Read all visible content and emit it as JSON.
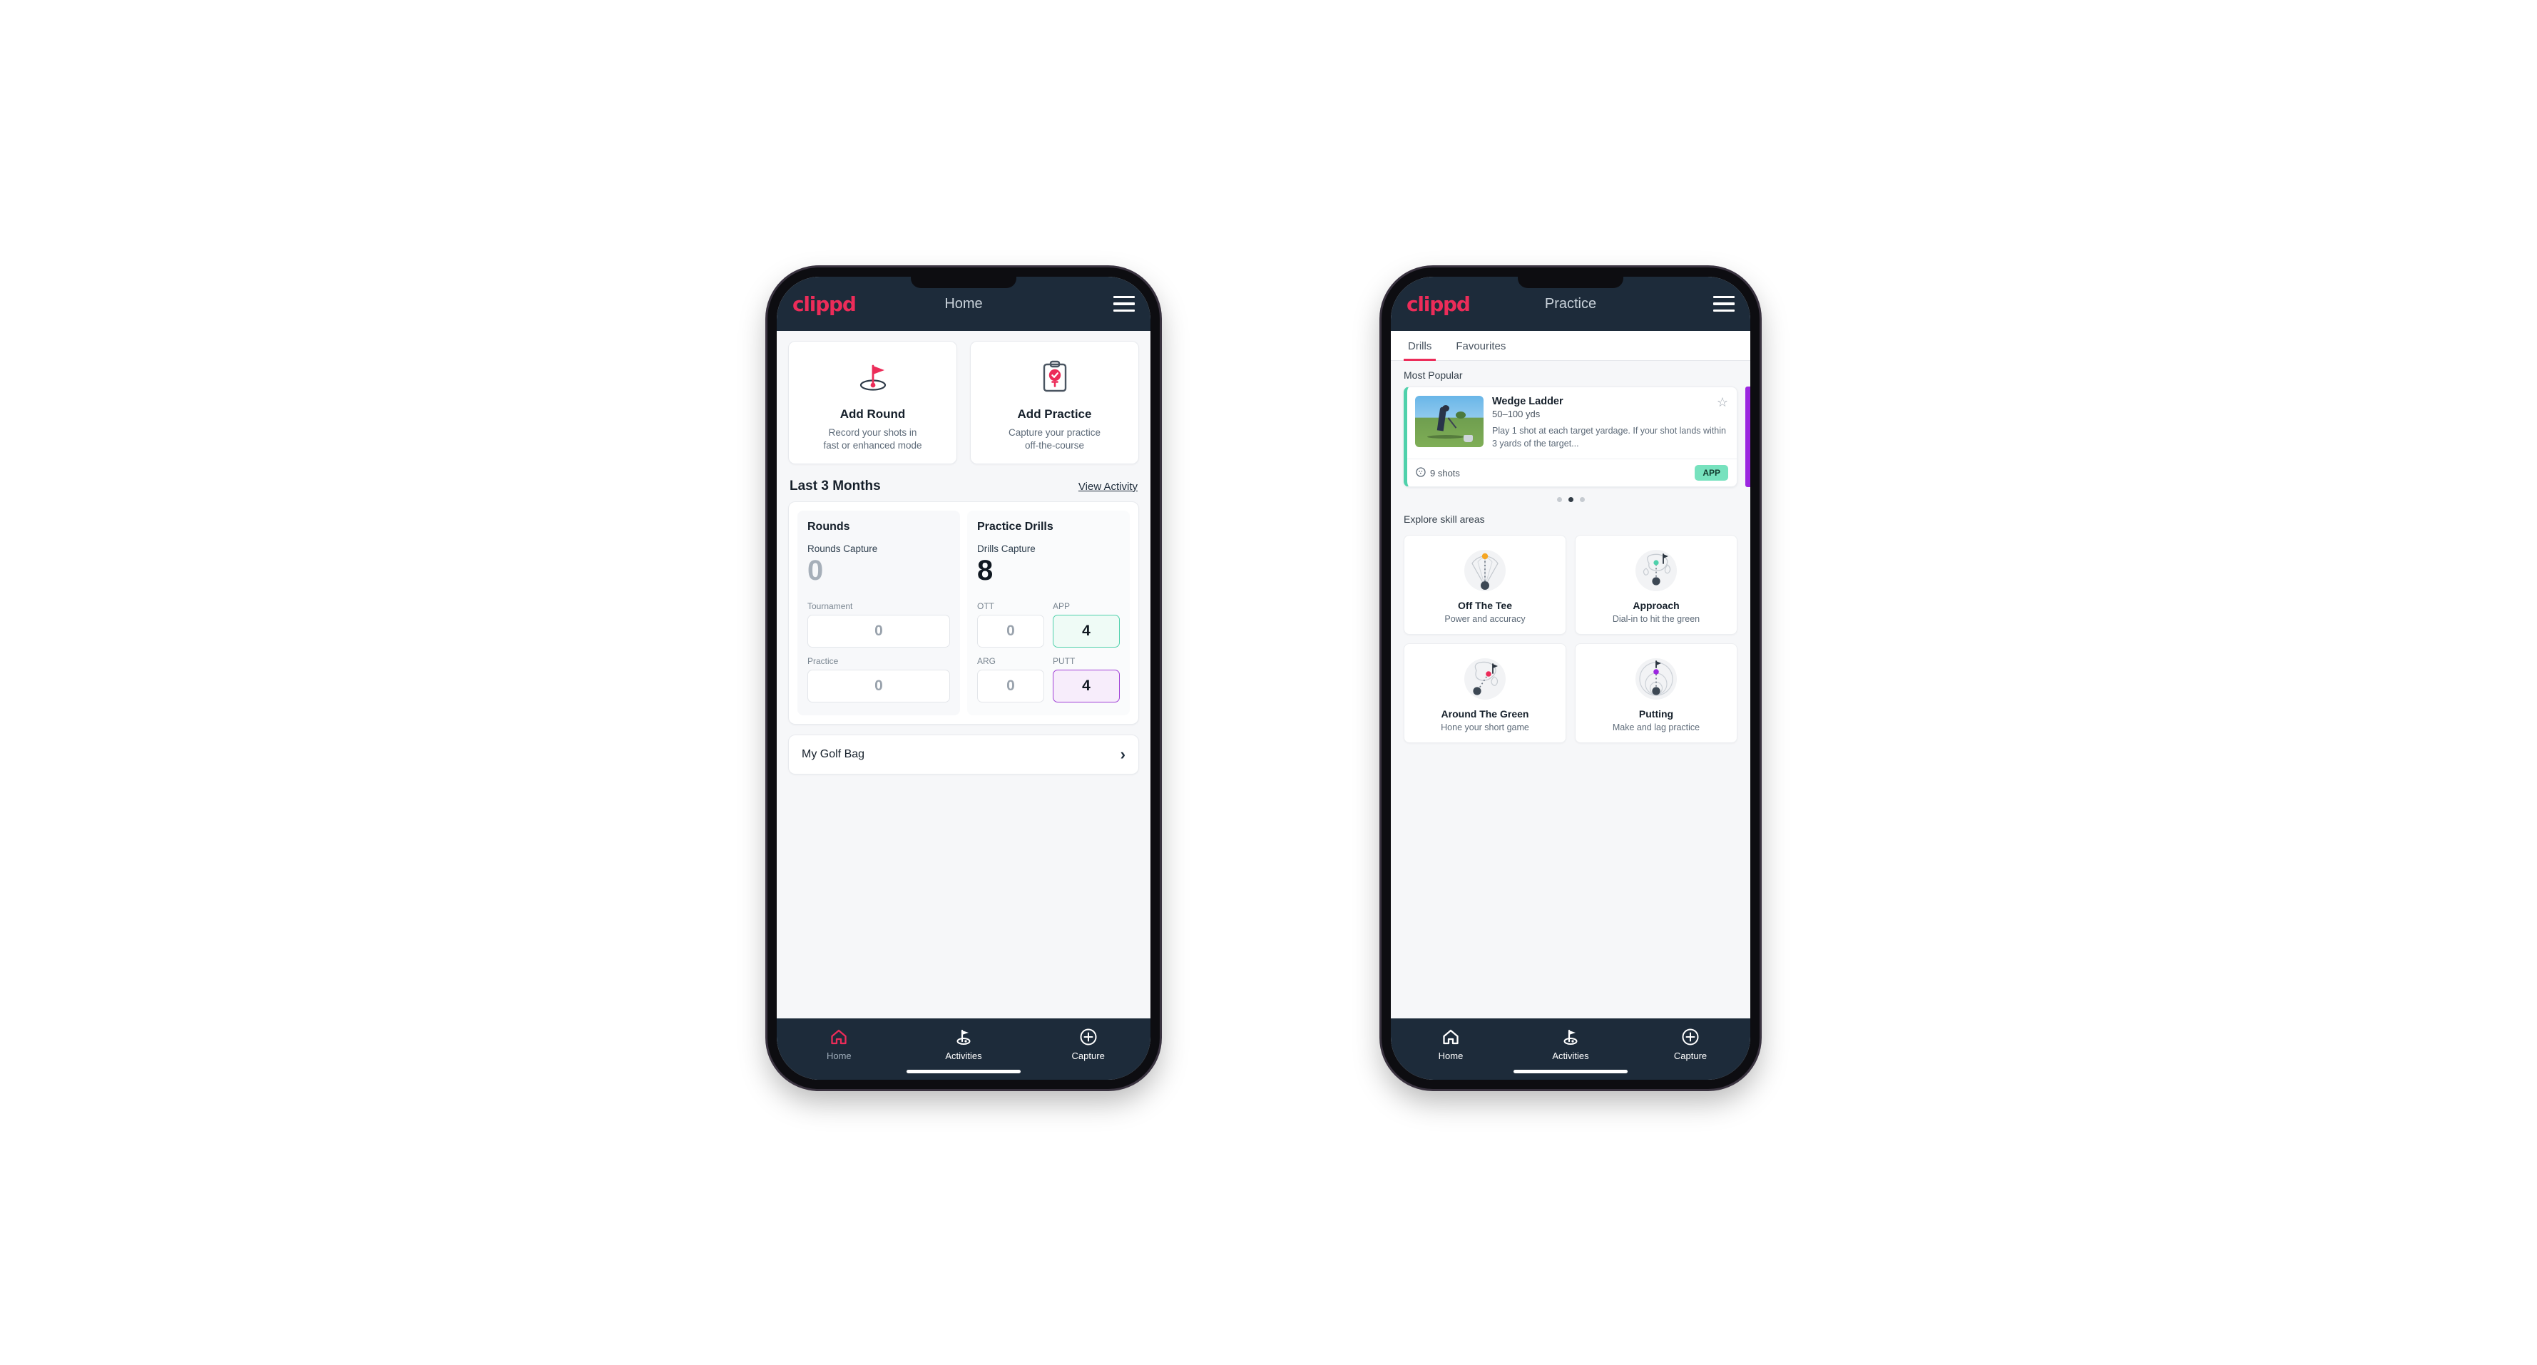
{
  "brand": {
    "logo_text": "clippd",
    "accent_pink": "#ec2c59",
    "navy": "#1d2b3a"
  },
  "phone1": {
    "appbar": {
      "title": "Home",
      "menu_icon": "hamburger-icon"
    },
    "quick_actions": [
      {
        "icon": "golf-flag-hole-icon",
        "title": "Add Round",
        "subtitle_line1": "Record your shots in",
        "subtitle_line2": "fast or enhanced mode"
      },
      {
        "icon": "clipboard-check-tee-icon",
        "title": "Add Practice",
        "subtitle_line1": "Capture your practice",
        "subtitle_line2": "off-the-course"
      }
    ],
    "section": {
      "title": "Last 3 Months",
      "link": "View Activity"
    },
    "rounds": {
      "title": "Rounds",
      "capture_label": "Rounds Capture",
      "capture_value": "0",
      "tournament_label": "Tournament",
      "tournament_value": "0",
      "practice_label": "Practice",
      "practice_value": "0"
    },
    "drills": {
      "title": "Practice Drills",
      "capture_label": "Drills Capture",
      "capture_value": "8",
      "ott_label": "OTT",
      "ott_value": "0",
      "app_label": "APP",
      "app_value": "4",
      "app_color": "#4fd1ab",
      "arg_label": "ARG",
      "arg_value": "0",
      "putt_label": "PUTT",
      "putt_value": "4",
      "putt_color": "#a13fd6"
    },
    "golf_bag": {
      "label": "My Golf Bag",
      "chevron": "›"
    },
    "nav": [
      {
        "icon": "home-icon",
        "label": "Home",
        "active": true
      },
      {
        "icon": "golf-flag-icon",
        "label": "Activities",
        "active": false
      },
      {
        "icon": "plus-circle-icon",
        "label": "Capture",
        "active": false
      }
    ]
  },
  "phone2": {
    "appbar": {
      "title": "Practice",
      "menu_icon": "hamburger-icon"
    },
    "tabs": [
      {
        "label": "Drills",
        "active": true
      },
      {
        "label": "Favourites",
        "active": false
      }
    ],
    "most_popular_label": "Most Popular",
    "drill": {
      "name": "Wedge Ladder",
      "yardage": "50–100 yds",
      "description": "Play 1 shot at each target yardage. If your shot lands within 3 yards of the target...",
      "shots": "9 shots",
      "shots_icon": "golf-ball-icon",
      "badge": "APP",
      "badge_color": "#77e2be",
      "accent_color": "#4fd1ab",
      "favourite_icon": "star-outline-icon",
      "thumbnail": "golfer-chipping-photo"
    },
    "carousel_dots": {
      "count": 3,
      "active_index": 1
    },
    "skills_label": "Explore skill areas",
    "skills": [
      {
        "icon": "tee-fan-icon",
        "title": "Off The Tee",
        "subtitle": "Power and accuracy",
        "dot_color": "#f5a623"
      },
      {
        "icon": "green-approach-icon",
        "title": "Approach",
        "subtitle": "Dial-in to hit the green",
        "dot_color": "#4fd1ab"
      },
      {
        "icon": "chip-green-icon",
        "title": "Around The Green",
        "subtitle": "Hone your short game",
        "dot_color": "#ec2c59"
      },
      {
        "icon": "putting-rings-icon",
        "title": "Putting",
        "subtitle": "Make and lag practice",
        "dot_color": "#9c27e0"
      }
    ],
    "nav": [
      {
        "icon": "home-icon",
        "label": "Home",
        "active": false
      },
      {
        "icon": "golf-flag-icon",
        "label": "Activities",
        "active": true
      },
      {
        "icon": "plus-circle-icon",
        "label": "Capture",
        "active": false
      }
    ]
  }
}
